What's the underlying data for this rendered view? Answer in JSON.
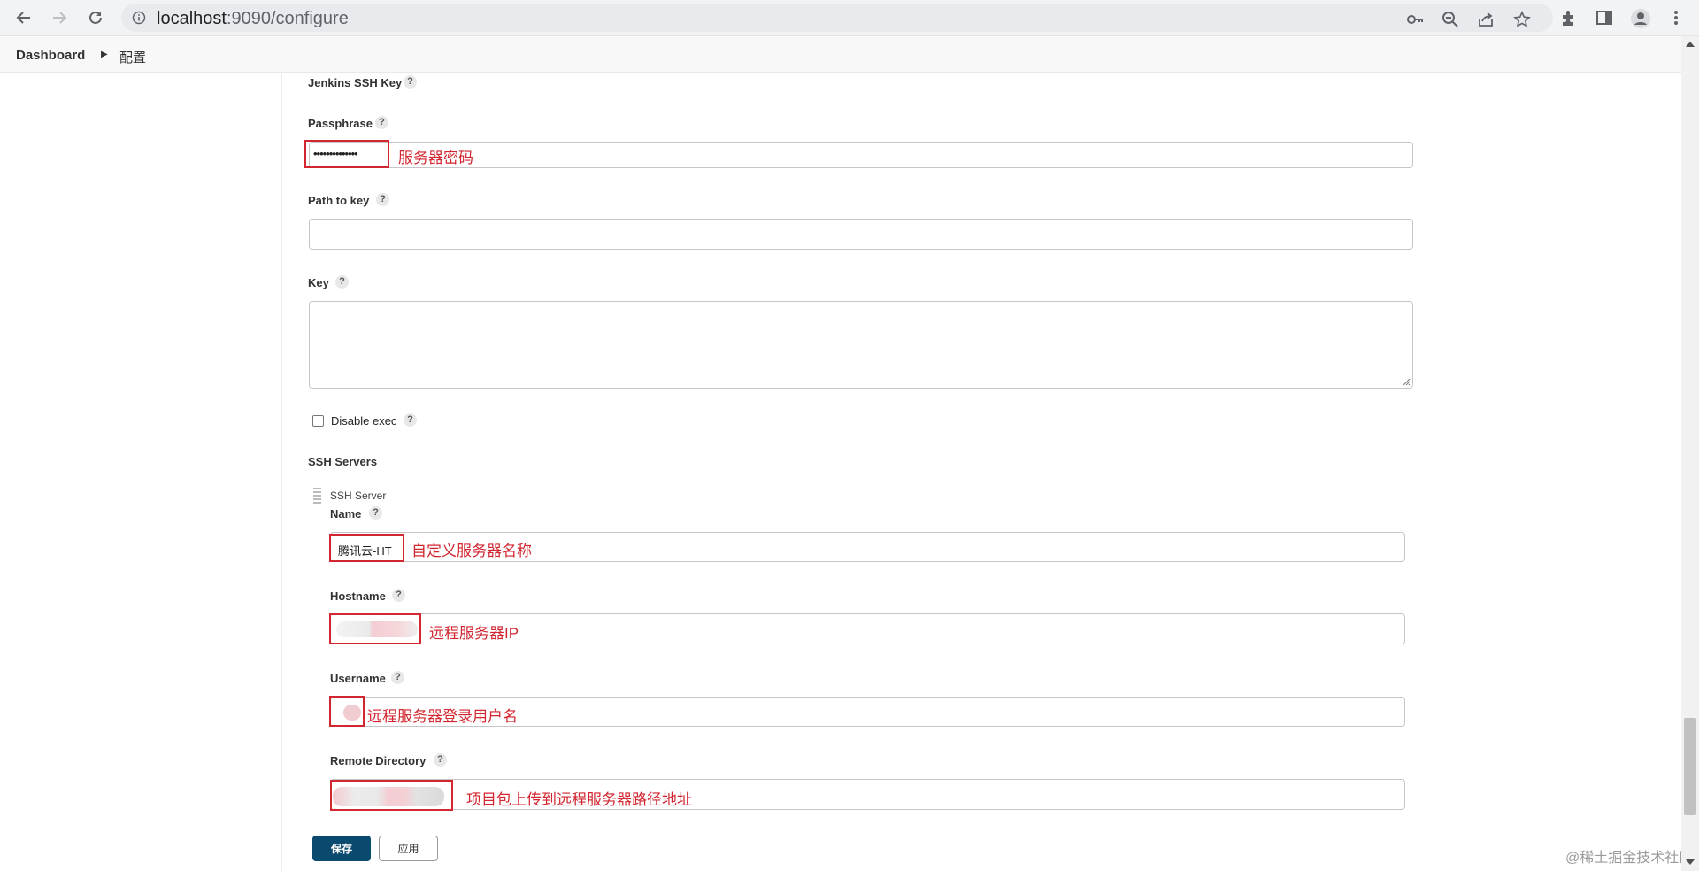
{
  "browser": {
    "url_host": "localhost",
    "url_path": ":9090/configure",
    "icons": [
      "back-icon",
      "forward-icon",
      "reload-icon",
      "info-icon",
      "key-icon",
      "zoom-icon",
      "share-icon",
      "star-icon",
      "extensions-icon",
      "sidepanel-icon",
      "profile-icon",
      "menu-icon"
    ]
  },
  "breadcrumb": {
    "dashboard": "Dashboard",
    "current": "配置"
  },
  "form": {
    "jenkins_ssh_key_label": "Jenkins SSH Key",
    "passphrase_label": "Passphrase",
    "passphrase_value": "••••••••••••••",
    "passphrase_note": "服务器密码",
    "path_to_key_label": "Path to key",
    "key_label": "Key",
    "disable_exec_label": "Disable exec",
    "ssh_servers_label": "SSH Servers",
    "ssh_server_label": "SSH Server",
    "name_label": "Name",
    "name_value": "腾讯云-HT",
    "name_note": "自定义服务器名称",
    "hostname_label": "Hostname",
    "hostname_note": "远程服务器IP",
    "username_label": "Username",
    "username_note": "远程服务器登录用户名",
    "remote_dir_label": "Remote Directory",
    "remote_dir_note": "项目包上传到远程服务器路径地址",
    "help": "?"
  },
  "buttons": {
    "save": "保存",
    "apply": "应用"
  },
  "watermark": "@稀土掘金技术社区",
  "colors": {
    "annotation": "#d22630",
    "save_button": "#0b4a6f"
  }
}
